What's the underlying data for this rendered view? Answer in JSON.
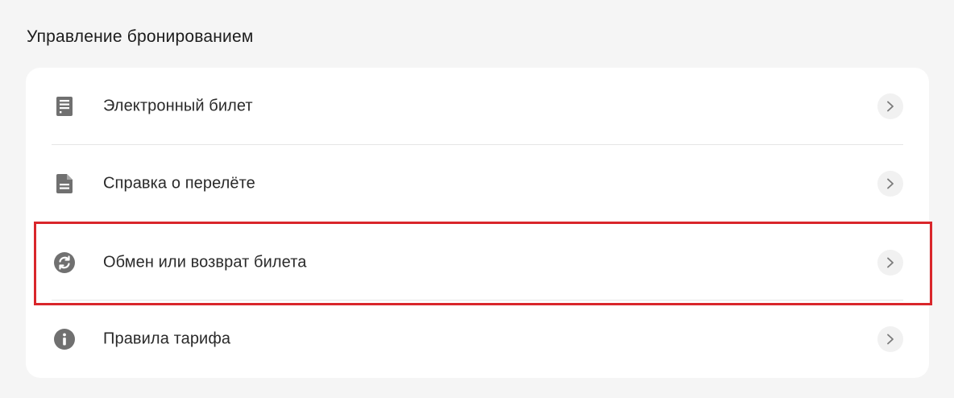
{
  "section": {
    "title": "Управление бронированием"
  },
  "menu": {
    "items": [
      {
        "label": "Электронный билет",
        "icon": "ticket-document-icon"
      },
      {
        "label": "Справка о перелёте",
        "icon": "file-document-icon"
      },
      {
        "label": "Обмен или возврат билета",
        "icon": "refresh-exchange-icon"
      },
      {
        "label": "Правила тарифа",
        "icon": "info-icon"
      }
    ],
    "highlighted_item": "Обмен или возврат билета"
  },
  "colors": {
    "background": "#f5f5f5",
    "card": "#ffffff",
    "icon": "#6f6f6f",
    "highlight": "#d9262b"
  }
}
